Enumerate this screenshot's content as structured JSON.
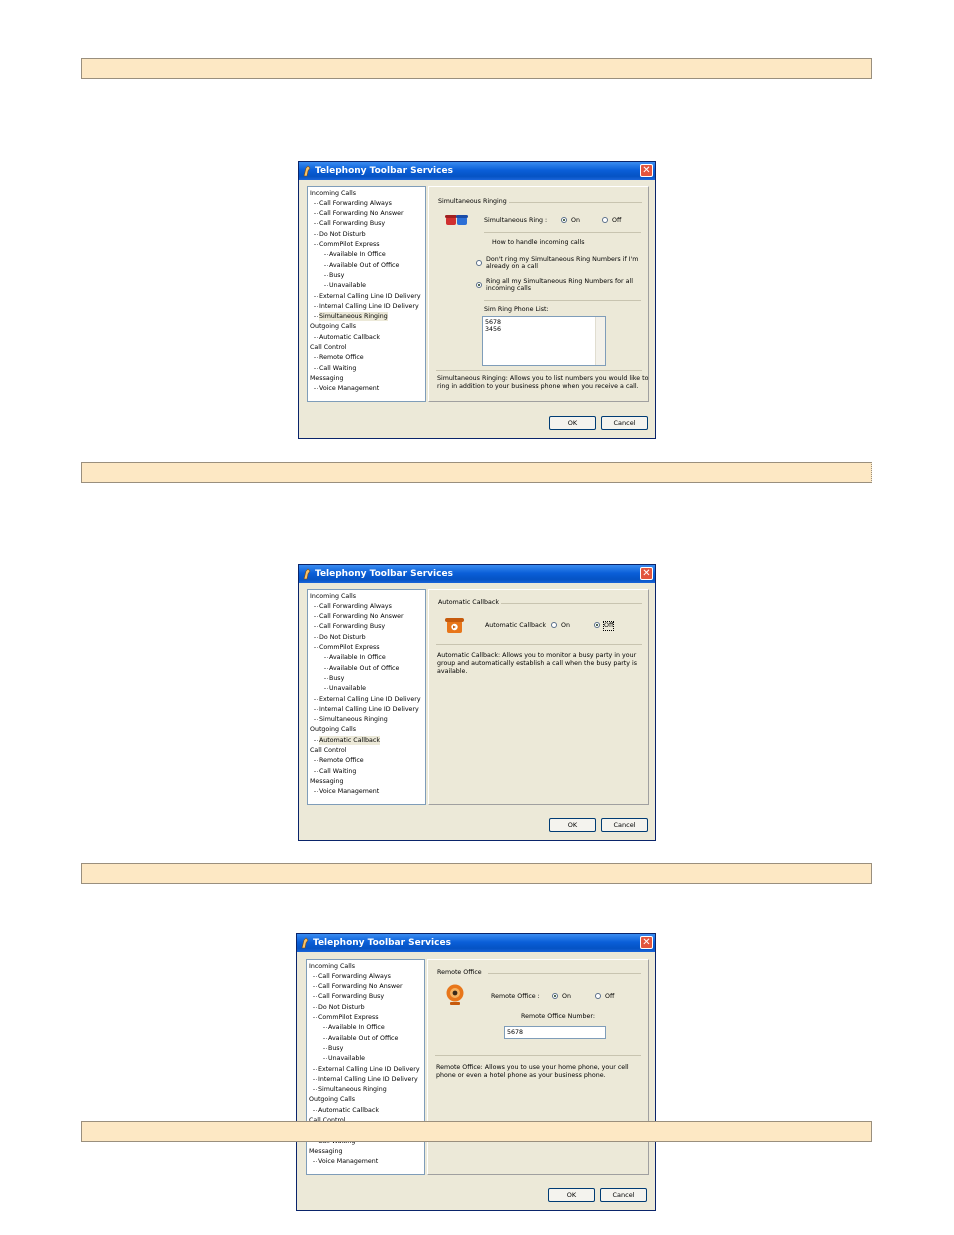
{
  "dialogs": {
    "title": "Telephony Toolbar Services",
    "ok_label": "OK",
    "cancel_label": "Cancel",
    "tree": {
      "incoming_calls": "Incoming Calls",
      "call_forwarding_always": "Call Forwarding Always",
      "call_forwarding_no_answer": "Call Forwarding No Answer",
      "call_forwarding_busy": "Call Forwarding Busy",
      "do_not_disturb": "Do Not Disturb",
      "commpilot_express": "CommPilot Express",
      "available_in_office": "Available In Office",
      "available_out_of_office": "Available Out of Office",
      "busy": "Busy",
      "unavailable": "Unavailable",
      "external_clid": "External Calling Line ID Delivery",
      "internal_clid": "Internal Calling Line ID Delivery",
      "simultaneous_ringing": "Simultaneous Ringing",
      "outgoing_calls": "Outgoing Calls",
      "automatic_callback": "Automatic Callback",
      "call_control": "Call Control",
      "remote_office": "Remote Office",
      "call_waiting": "Call Waiting",
      "messaging": "Messaging",
      "voice_management": "Voice Management"
    }
  },
  "simring": {
    "group_title": "Simultaneous Ringing",
    "toggle_label": "Simultaneous Ring :",
    "on_label": "On",
    "off_label": "Off",
    "selected": "On",
    "handle_label": "How to handle incoming calls",
    "option1_line1": "Don't ring my Simultaneous Ring Numbers if I'm",
    "option1_line2": "already on a call",
    "option2_line1": "Ring all my Simultaneous Ring Numbers for all",
    "option2_line2": "incoming calls",
    "phone_list_label": "Sim Ring Phone List:",
    "phone_numbers": [
      "5678",
      "3456"
    ],
    "desc_line1": "Simultaneous Ringing: Allows you to list numbers you would like to",
    "desc_line2": "ring in addition to your business phone when you receive a call."
  },
  "callback": {
    "group_title": "Automatic Callback",
    "toggle_label": "Automatic Callback",
    "on_label": "On",
    "off_label": "Off",
    "selected": "Off",
    "desc_line1": "Automatic Callback: Allows you to monitor a busy party in your",
    "desc_line2": "group and automatically establish a call when the busy party is",
    "desc_line3": "available."
  },
  "remote": {
    "group_title": "Remote Office",
    "toggle_label": "Remote Office :",
    "on_label": "On",
    "off_label": "Off",
    "selected": "On",
    "number_label": "Remote Office Number:",
    "number_value": "5678",
    "desc_line1": "Remote Office: Allows you to use your home phone, your cell",
    "desc_line2": "phone or even a hotel phone as your business phone."
  },
  "colors": {
    "section_bar": "#fde8c4",
    "dialog_face": "#ece9d8",
    "title_blue": "#0a5fd8",
    "close_red": "#e2553e",
    "icon_orange": "#e8761a"
  }
}
